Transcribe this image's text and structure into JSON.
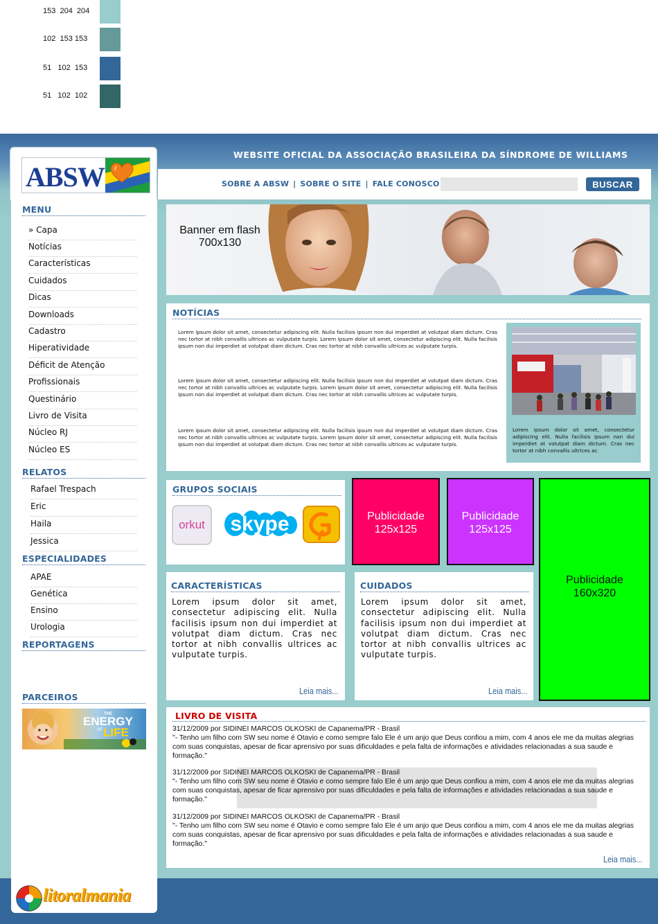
{
  "palette": [
    {
      "label": "153  204  204",
      "hex": "#99cccc"
    },
    {
      "label": "102  153 153",
      "hex": "#669999"
    },
    {
      "label": "51   102  153",
      "hex": "#336699"
    },
    {
      "label": "51   102  102",
      "hex": "#336666"
    }
  ],
  "header": {
    "logo_text": "ABSW",
    "title": "WEBSITE OFICIAL DA ASSOCIAÇÃO BRASILEIRA DA SÍNDROME DE WILLIAMS",
    "links": [
      "SOBRE A ABSW",
      "SOBRE O SITE",
      "FALE CONOSCO"
    ],
    "link_sep": "|",
    "search_value": "",
    "search_button": "BUSCAR"
  },
  "sidebar": {
    "menu_heading": "MENU",
    "menu": [
      "» Capa",
      "Notícias",
      "Características",
      "Cuidados",
      "Dicas",
      "Downloads",
      "Cadastro",
      "Hiperatividade",
      "Déficit de Atenção",
      "Profissionais",
      "Questinário",
      "Livro de Visita",
      "Núcleo RJ",
      "Núcleo ES"
    ],
    "relatos_heading": "RELATOS",
    "relatos": [
      "Rafael Trespach",
      "Eric",
      "Haila",
      "Jessica"
    ],
    "especialidades_heading": "ESPECIALIDADES",
    "especialidades": [
      "APAE",
      "Genética",
      "Ensino",
      "Urologia"
    ],
    "reportagens_heading": "REPORTAGENS",
    "parceiros_heading": "PARCEIROS",
    "partner_text": [
      "THE",
      "ENERGY",
      "OF",
      "LIFE"
    ]
  },
  "banner": {
    "line1": "Banner em flash",
    "line2": "700x130"
  },
  "news": {
    "heading": "NOTÍCIAS",
    "paragraph": "Lorem ipsum dolor sit amet, consectetur adipiscing elit. Nulla facilisis ipsum non dui imperdiet at volutpat diam dictum. Cras nec tortor at nibh convallis ultrices ac vulputate turpis. Lorem ipsum dolor sit amet, consectetur adipiscing elit. Nulla facilisis ipsum non dui imperdiet at volutpat diam dictum. Cras nec tortor at nibh convallis ultrices ac vulputate turpis.",
    "caption": "Lorem ipsum dolor sit amet, consectetur adipiscing elit. Nulla facilisis ipsum non dui imperdiet at volutpat diam dictum. Cras nec tortor at nibh convallis ultrices ac"
  },
  "social": {
    "heading": "GRUPOS SOCIAIS",
    "orkut": "orkut",
    "skype": "skype"
  },
  "ads": [
    {
      "line1": "Publicidade",
      "line2": "125x125",
      "color": "#ff0066"
    },
    {
      "line1": "Publicidade",
      "line2": "125x125",
      "color": "#cc33ff"
    },
    {
      "line1": "Publicidade",
      "line2": "160x320",
      "color": "#00ff00"
    }
  ],
  "features": {
    "caracteristicas_heading": "CARACTERÍSTICAS",
    "cuidados_heading": "CUIDADOS",
    "text": "Lorem ipsum dolor sit amet, consectetur adipiscing elit. Nulla facilisis ipsum non dui imperdiet at volutpat diam dictum. Cras nec tortor at nibh convallis ultrices ac vulputate turpis.",
    "more": "Leia mais..."
  },
  "guestbook": {
    "heading": "LIVRO DE VISITA",
    "entries": [
      {
        "meta": "31/12/2009  por SIDINEI MARCOS OLKOSKI de Capanema/PR - Brasil",
        "message": " \"- Tenho um filho com SW seu nome é Otavio e como sempre falo Ele é um anjo que Deus confiou a mim, com 4 anos ele me da muitas alegrias com suas conquistas, apesar de ficar aprensivo por suas dificuldades e pela falta de informações e atividades relacionadas a sua saude e formação.\""
      },
      {
        "meta": "31/12/2009  por SIDINEI MARCOS OLKOSKI de Capanema/PR - Brasil",
        "message": " \"- Tenho um filho com SW seu nome é Otavio e como sempre falo Ele é um anjo que Deus confiou a mim, com 4 anos ele me da muitas alegrias com suas conquistas, apesar de ficar aprensivo por suas dificuldades e pela falta de informações e atividades relacionadas a sua saude e formação.\""
      },
      {
        "meta": "31/12/2009  por SIDINEI MARCOS OLKOSKI de Capanema/PR - Brasil",
        "message": " \"- Tenho um filho com SW seu nome é Otavio e como sempre falo Ele é um anjo que Deus confiou a mim, com 4 anos ele me da muitas alegrias com suas conquistas, apesar de ficar aprensivo por suas dificuldades e pela falta de informações e atividades relacionadas a sua saude e formação.\""
      }
    ],
    "more": "Leia mais..."
  },
  "footer": {
    "brand": "litoralmania"
  },
  "colors": {
    "primary": "#336699",
    "accent": "#99cccc",
    "guestbook_heading": "#cc0000"
  }
}
